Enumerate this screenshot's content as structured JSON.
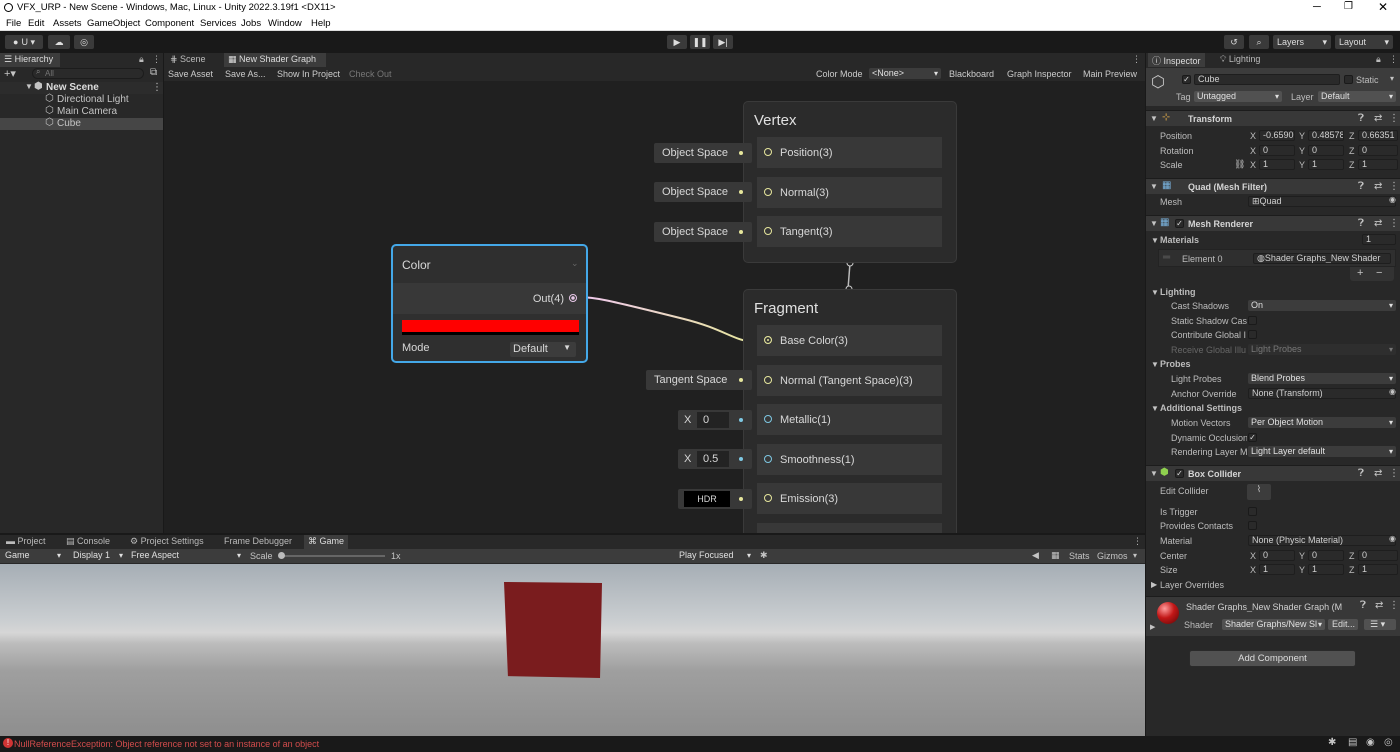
{
  "window": {
    "title": "VFX_URP - New Scene - Windows, Mac, Linux - Unity 2022.3.19f1 <DX11>"
  },
  "menu": [
    "File",
    "Edit",
    "Assets",
    "GameObject",
    "Component",
    "Services",
    "Jobs",
    "Window",
    "Help"
  ],
  "toolbar": {
    "account": "U",
    "layers": "Layers",
    "layout": "Layout"
  },
  "hierarchy": {
    "tab": "Hierarchy",
    "search_placeholder": "All",
    "scene": "New Scene",
    "items": [
      "Directional Light",
      "Main Camera",
      "Cube"
    ]
  },
  "graph": {
    "tabs": [
      "Scene",
      "New Shader Graph"
    ],
    "toolbar": {
      "save": "Save Asset",
      "save_as": "Save As...",
      "show": "Show In Project",
      "checkout": "Check Out",
      "color_mode_label": "Color Mode",
      "color_mode": "<None>",
      "blackboard": "Blackboard",
      "inspector": "Graph Inspector",
      "preview": "Main Preview"
    },
    "vertex": {
      "title": "Vertex",
      "slots": [
        "Position(3)",
        "Normal(3)",
        "Tangent(3)"
      ],
      "inputs": [
        "Object Space",
        "Object Space",
        "Object Space"
      ]
    },
    "fragment": {
      "title": "Fragment",
      "slots": [
        "Base Color(3)",
        "Normal (Tangent Space)(3)",
        "Metallic(1)",
        "Smoothness(1)",
        "Emission(3)"
      ],
      "tangent_input": "Tangent Space",
      "metallic_axis": "X",
      "metallic": "0",
      "smooth_axis": "X",
      "smooth": "0.5",
      "hdr": "HDR"
    },
    "color_node": {
      "title": "Color",
      "out": "Out(4)",
      "swatch": "#ff0000",
      "mode_label": "Mode",
      "mode": "Default"
    }
  },
  "bottom": {
    "tabs": [
      "Project",
      "Console",
      "Project Settings",
      "Frame Debugger",
      "Game"
    ],
    "game_bar": {
      "game": "Game",
      "display": "Display 1",
      "aspect": "Free Aspect",
      "scale_label": "Scale",
      "scale_val": "1x",
      "play_focused": "Play Focused",
      "stats": "Stats",
      "gizmos": "Gizmos"
    },
    "cube_color": "#7a1c1e"
  },
  "status": {
    "error": "NullReferenceException: Object reference not set to an instance of an object"
  },
  "inspector": {
    "tabs": [
      "Inspector",
      "Lighting"
    ],
    "name": "Cube",
    "static": "Static",
    "tag_label": "Tag",
    "tag": "Untagged",
    "layer_label": "Layer",
    "layer": "Default",
    "transform": {
      "title": "Transform",
      "position_label": "Position",
      "rotation_label": "Rotation",
      "scale_label": "Scale",
      "pos": [
        "-0.6590",
        "0.48578",
        "0.66351"
      ],
      "rot": [
        "0",
        "0",
        "0"
      ],
      "scl": [
        "1",
        "1",
        "1"
      ]
    },
    "mesh_filter": {
      "title": "Quad (Mesh Filter)",
      "mesh_label": "Mesh",
      "mesh": "Quad"
    },
    "mesh_renderer": {
      "title": "Mesh Renderer",
      "materials_label": "Materials",
      "materials_count": "1",
      "element_label": "Element 0",
      "element": "Shader Graphs_New Shader",
      "lighting_label": "Lighting",
      "cast_label": "Cast Shadows",
      "cast": "On",
      "static_shadow": "Static Shadow Cas",
      "contribute_gi": "Contribute Global I",
      "receive_gi": "Receive Global Illu",
      "receive_gi_val": "Light Probes",
      "probes_label": "Probes",
      "light_probes_label": "Light Probes",
      "light_probes": "Blend Probes",
      "anchor_label": "Anchor Override",
      "anchor": "None (Transform)",
      "additional_label": "Additional Settings",
      "motion_label": "Motion Vectors",
      "motion": "Per Object Motion",
      "dyn_occl": "Dynamic Occlusion",
      "render_layer_label": "Rendering Layer M",
      "render_layer": "Light Layer default"
    },
    "box_collider": {
      "title": "Box Collider",
      "edit_label": "Edit Collider",
      "trigger_label": "Is Trigger",
      "contacts_label": "Provides Contacts",
      "material_label": "Material",
      "material": "None (Physic Material)",
      "center_label": "Center",
      "center": [
        "0",
        "0",
        "0"
      ],
      "size_label": "Size",
      "size": [
        "1",
        "1",
        "1"
      ],
      "overrides": "Layer Overrides"
    },
    "material": {
      "name": "Shader Graphs_New Shader Graph (M",
      "shader_label": "Shader",
      "shader": "Shader Graphs/New Sl",
      "edit": "Edit..."
    },
    "add_component": "Add Component",
    "axis": [
      "X",
      "Y",
      "Z"
    ]
  }
}
